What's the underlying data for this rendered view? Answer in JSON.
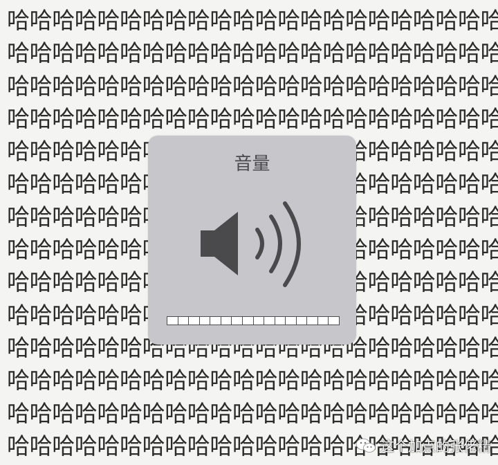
{
  "background": {
    "char": "哈",
    "chars_per_row": 22,
    "rows": 14,
    "text_color": "#2b2b2b",
    "color": "#f4f4f2"
  },
  "volume_hud": {
    "title": "音量",
    "icon": "speaker-icon",
    "level": 0,
    "segments": 16,
    "panel_color": "#c7c7cb",
    "icon_color": "#4a4a4c"
  },
  "watermark": {
    "icon": "wechat-icon",
    "text": "这个加点的张佬精"
  }
}
